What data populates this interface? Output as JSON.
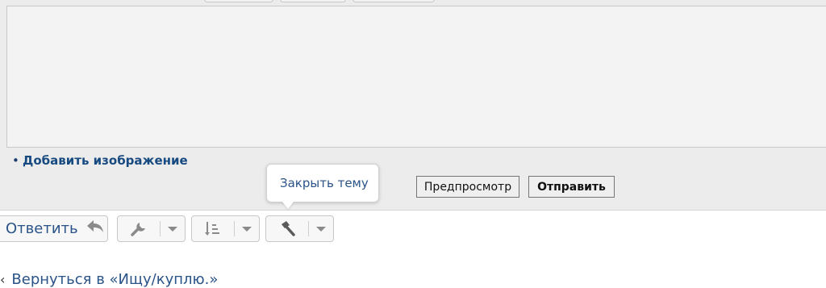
{
  "editor": {
    "add_image_label": "Добавить изображение",
    "bullet": "•"
  },
  "tooltip": {
    "text": "Закрыть тему"
  },
  "form_buttons": {
    "preview_label": "Предпросмотр",
    "submit_label": "Отправить"
  },
  "toolbar": {
    "reply_label": "Ответить",
    "icons": [
      "reply-arrow-icon",
      "wrench-icon",
      "sort-icon",
      "hammer-icon",
      "chevron-down-icon"
    ]
  },
  "navigation": {
    "back_label": "Вернуться в «Ищу/куплю.»"
  },
  "colors": {
    "link": "#2a5388",
    "panel_bg": "#ececec",
    "icon_gray": "#8a8a8a"
  }
}
